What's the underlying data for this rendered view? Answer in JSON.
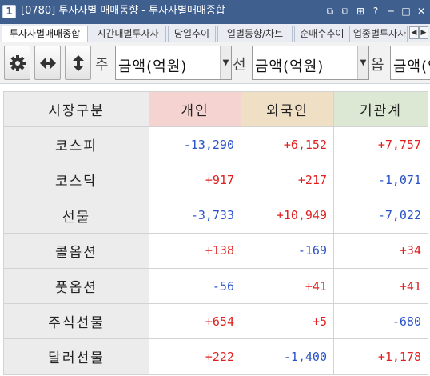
{
  "window": {
    "number": "1",
    "title": "[0780] 투자자별 매매동향 - 투자자별매매종합",
    "controls": [
      "⧉",
      "⧉",
      "⊞",
      "?",
      "─",
      "□",
      "✕"
    ]
  },
  "tabs": [
    "투자자별매매종합",
    "시간대별투자자",
    "당일추이",
    "일별동향/차트",
    "순매수추이",
    "업종별투자자"
  ],
  "tab_scroll": {
    "left": "◀",
    "right": "▶"
  },
  "toolbar": {
    "icons": [
      "gear-icon",
      "horizontal-arrows-icon",
      "vertical-arrows-icon"
    ],
    "selects": [
      {
        "label": "주",
        "value": "금액(억원)"
      },
      {
        "label": "선",
        "value": "금액(억원)"
      },
      {
        "label": "옵",
        "value": "금액(억원)"
      }
    ],
    "arrow": "▼"
  },
  "table": {
    "headers": [
      "시장구분",
      "개인",
      "외국인",
      "기관계"
    ],
    "rows": [
      {
        "market": "코스피",
        "individual": "-13,290",
        "foreign": "+6,152",
        "institution": "+7,757"
      },
      {
        "market": "코스닥",
        "individual": "+917",
        "foreign": "+217",
        "institution": "-1,071"
      },
      {
        "market": "선물",
        "individual": "-3,733",
        "foreign": "+10,949",
        "institution": "-7,022"
      },
      {
        "market": "콜옵션",
        "individual": "+138",
        "foreign": "-169",
        "institution": "+34"
      },
      {
        "market": "풋옵션",
        "individual": "-56",
        "foreign": "+41",
        "institution": "+41"
      },
      {
        "market": "주식선물",
        "individual": "+654",
        "foreign": "+5",
        "institution": "-680"
      },
      {
        "market": "달러선물",
        "individual": "+222",
        "foreign": "-1,400",
        "institution": "+1,178"
      }
    ]
  },
  "colors": {
    "titlebar": "#3f5f8f",
    "positive": "#e02020",
    "negative": "#2a52c9",
    "header_individual": "#f5d3d1",
    "header_foreign": "#efdfc4",
    "header_institution": "#dce8d3"
  }
}
